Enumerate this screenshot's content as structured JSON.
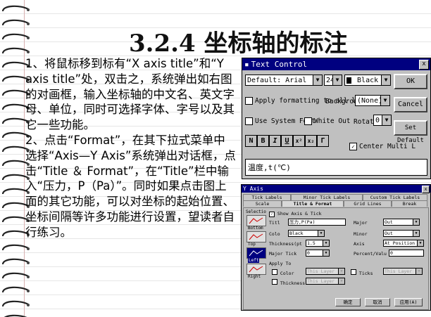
{
  "slide": {
    "title": "3.2.4 坐标轴的标注",
    "paragraph1": "1、将鼠标移到标有“X axis title”和“Y axis title”处，双击之，系统弹出如右图的对画框，输入坐标轴的中文名、英文字母、单位，同时可选择字体、字号以及其它一些功能。",
    "paragraph2": "2、点击“Format”，在其下拉式菜单中选择“Axis—Y Axis”系统弹出对话框，点击“Title ＆ Format”，在“Title”栏中输入“压力，P（Pa）”。同时如果点击图上面的其它功能，可以对坐标的起始位置、坐标间隔等许多功能进行设置，望读者自行练习。"
  },
  "text_control": {
    "title": "Text Control",
    "close": "x",
    "font_value": "Default: Arial",
    "size_value": "24",
    "color_value": "Black",
    "ok": "OK",
    "apply_all": "Apply formatting to all l",
    "background_label": "Background",
    "background_value": "(None)",
    "cancel": "Cancel",
    "use_system_font": "Use System Font",
    "white_out": "White Out",
    "rotate_label": "Rotate",
    "rotate_value": "0",
    "set_default": "Set Default",
    "fmt_n": "N",
    "fmt_b": "B",
    "fmt_i": "I",
    "fmt_u": "U",
    "fmt_sup": "x²",
    "fmt_sub": "x₂",
    "fmt_greek": "Γ",
    "center_multi": "Center Multi L",
    "center_multi_check": "✓",
    "edit_text": "温度,t(℃)"
  },
  "y_axis": {
    "title": "Y Axis",
    "close": "x",
    "tabs_row1": [
      "Tick Labels",
      "Minor Tick Labels",
      "Custom Tick Labels"
    ],
    "tabs_row2": [
      "Scale",
      "Title & Format",
      "Grid Lines",
      "Break"
    ],
    "selection_label": "Selectio",
    "side_items": [
      "Bottom",
      "Top",
      "Left",
      "Right"
    ],
    "show_axis": "Show Axis & Tick",
    "show_axis_check": "✓",
    "title_label": "Titl",
    "title_value": "压力,P(Pa)",
    "color_label": "Colo",
    "color_value": "Black",
    "thickness_label": "Thickness(pt",
    "thickness_value": "1.5",
    "major_tick_label": "Major Tick",
    "major_tick_value": "0",
    "major_label": "Major",
    "major_value": "Out",
    "minor_label": "Minor",
    "minor_value": "Out",
    "axis_label": "Axis",
    "axis_value": "At Position",
    "percent_label": "Percent/Valu",
    "percent_value": "0",
    "apply_to": "Apply To",
    "apply_color": "Color",
    "apply_color_value": "This Layer",
    "apply_ticks": "Ticks",
    "apply_ticks_value": "This Layer",
    "apply_thickness": "Thickness",
    "apply_thickness_value": "This Layer",
    "ok": "确定",
    "cancel": "取消",
    "apply": "应用(A)"
  }
}
